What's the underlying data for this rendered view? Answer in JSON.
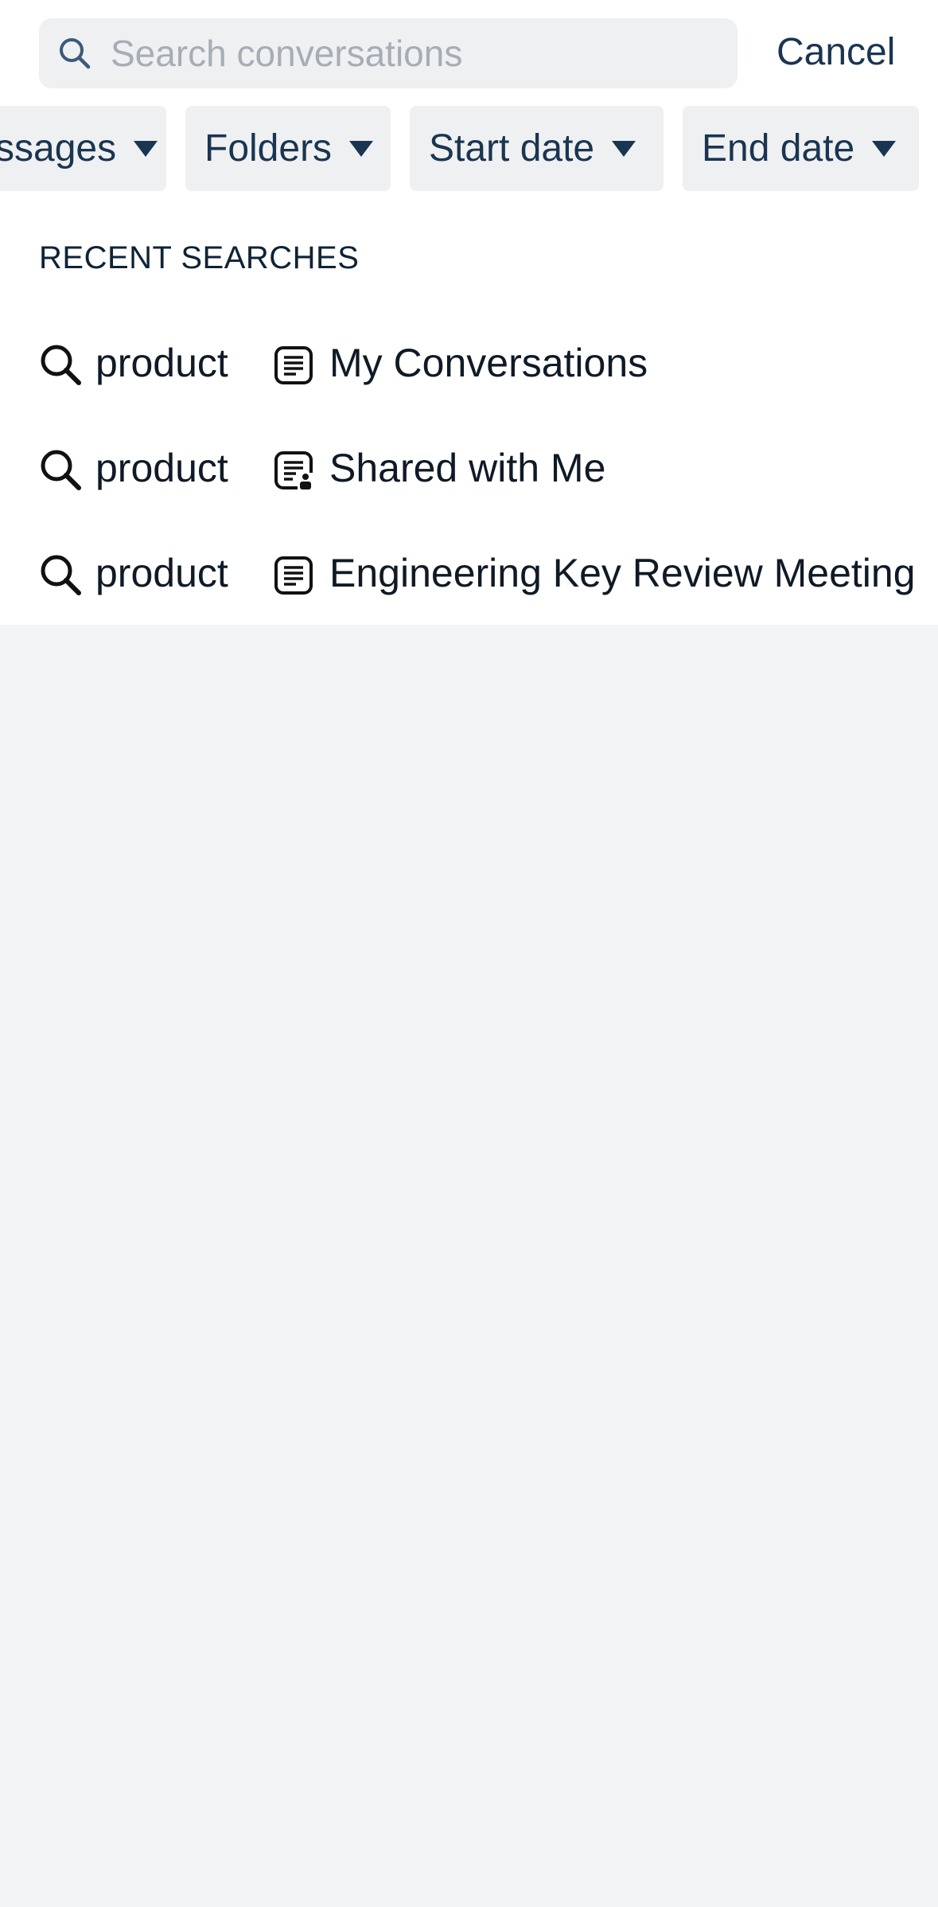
{
  "search": {
    "placeholder": "Search conversations",
    "value": "",
    "cancel_label": "Cancel"
  },
  "filters": [
    {
      "label": "ssages"
    },
    {
      "label": "Folders"
    },
    {
      "label": "Start date"
    },
    {
      "label": "End date"
    }
  ],
  "recent": {
    "title": "RECENT SEARCHES",
    "items": [
      {
        "query": "product",
        "scope": "My Conversations",
        "scope_icon": "document-icon"
      },
      {
        "query": "product",
        "scope": "Shared with Me",
        "scope_icon": "shared-document-icon"
      },
      {
        "query": "product",
        "scope": "Engineering Key Review Meeting",
        "scope_icon": "document-icon"
      }
    ]
  },
  "colors": {
    "accent_text": "#1a3550",
    "chip_bg": "#eff0f2",
    "page_bg": "#f2f4f6",
    "placeholder": "#a7adb5"
  }
}
